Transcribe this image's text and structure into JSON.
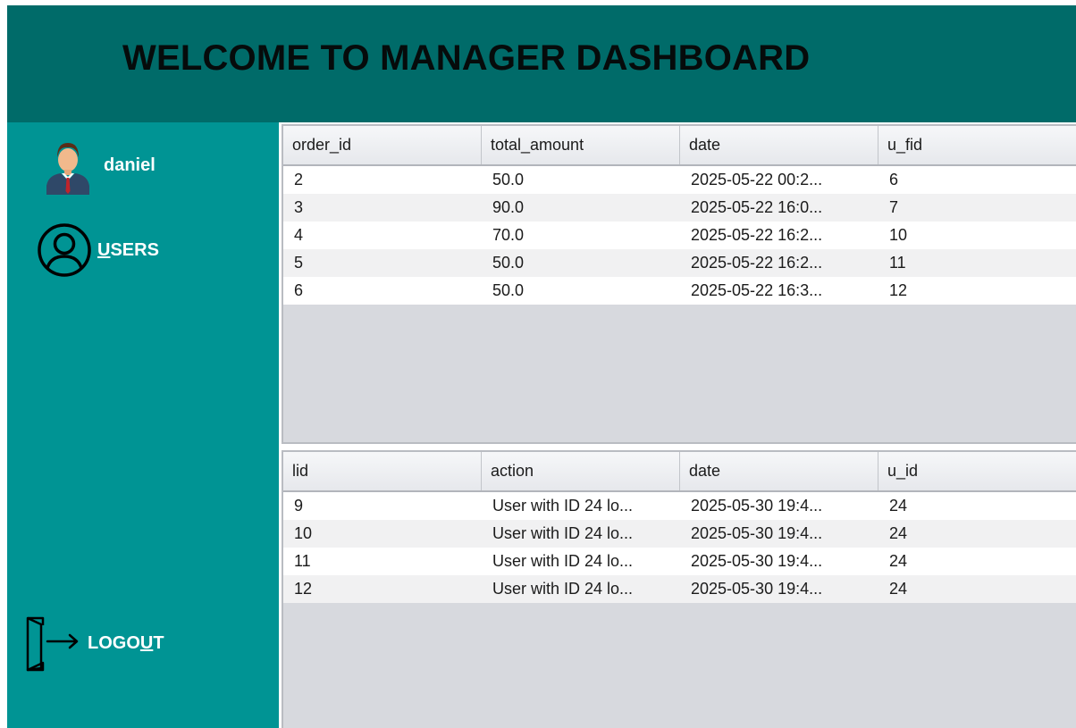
{
  "header": {
    "title": "WELCOME TO MANAGER DASHBOARD"
  },
  "sidebar": {
    "username": "daniel",
    "users": {
      "mnemonic": "U",
      "rest": "SERS",
      "icon": "user-circle-icon"
    },
    "logout": {
      "prefix": "LOGO",
      "mnemonic": "U",
      "suffix": "T",
      "icon": "logout-door-icon"
    }
  },
  "orders_table": {
    "columns": [
      "order_id",
      "total_amount",
      "date",
      "u_fid"
    ],
    "rows": [
      [
        "2",
        "50.0",
        "2025-05-22 00:2...",
        "6"
      ],
      [
        "3",
        "90.0",
        "2025-05-22 16:0...",
        "7"
      ],
      [
        "4",
        "70.0",
        "2025-05-22 16:2...",
        "10"
      ],
      [
        "5",
        "50.0",
        "2025-05-22 16:2...",
        "11"
      ],
      [
        "6",
        "50.0",
        "2025-05-22 16:3...",
        "12"
      ]
    ]
  },
  "logs_table": {
    "columns": [
      "lid",
      "action",
      "date",
      "u_id"
    ],
    "rows": [
      [
        "9",
        "User with ID 24 lo...",
        "2025-05-30 19:4...",
        "24"
      ],
      [
        "10",
        "User with ID 24 lo...",
        "2025-05-30 19:4...",
        "24"
      ],
      [
        "11",
        "User with ID 24 lo...",
        "2025-05-30 19:4...",
        "24"
      ],
      [
        "12",
        "User with ID 24 lo...",
        "2025-05-30 19:4...",
        "24"
      ]
    ]
  },
  "colors": {
    "header_bg": "#006b69",
    "sidebar_bg": "#009494",
    "table_empty_bg": "#d7d9de"
  }
}
